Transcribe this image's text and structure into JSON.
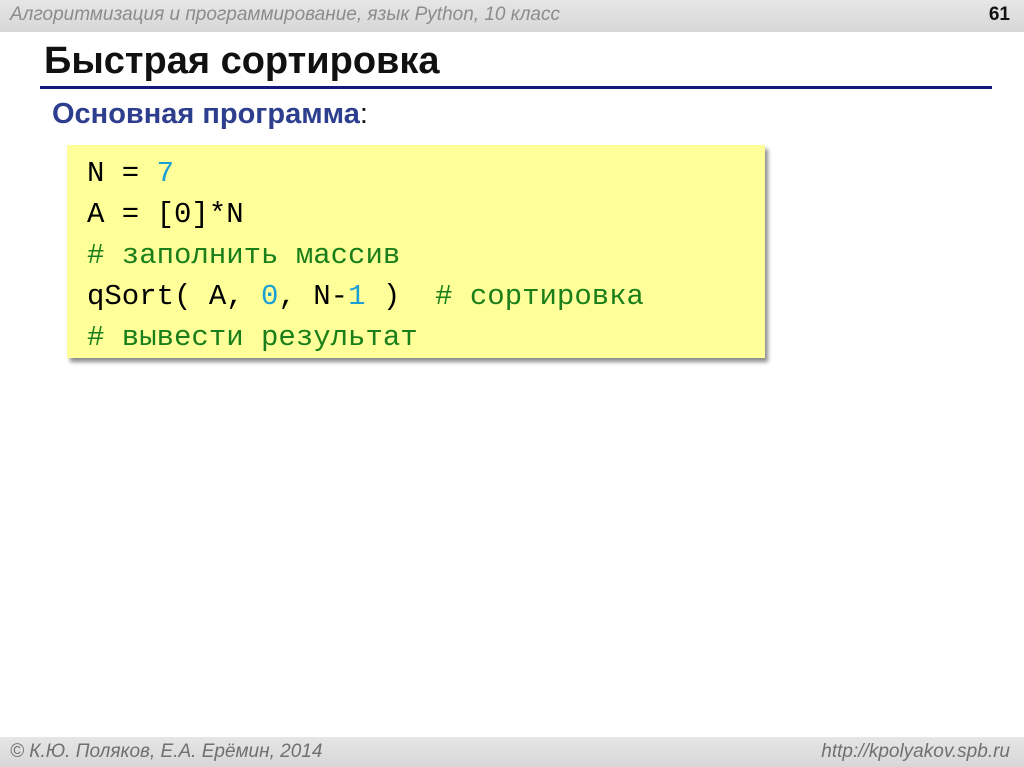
{
  "header": {
    "course": "Алгоритмизация и программирование, язык Python, 10 класс",
    "slide_number": "61"
  },
  "slide": {
    "title": "Быстрая сортировка",
    "subtitle": "Основная программа",
    "subtitle_colon": ":"
  },
  "code": {
    "line1": {
      "a": "N",
      "b": " = ",
      "c": "7"
    },
    "line2": {
      "a": "A = [0]*N"
    },
    "line3": {
      "a": "# заполнить массив"
    },
    "line4": {
      "a": "qSort( A, ",
      "b": "0",
      "c": ", N-",
      "d": "1",
      "e": " )  ",
      "f": "# сортировка"
    },
    "line5": {
      "a": "# вывести результат"
    }
  },
  "footer": {
    "authors": "© К.Ю. Поляков, Е.А. Ерёмин, 2014",
    "url": "http://kpolyakov.spb.ru"
  }
}
